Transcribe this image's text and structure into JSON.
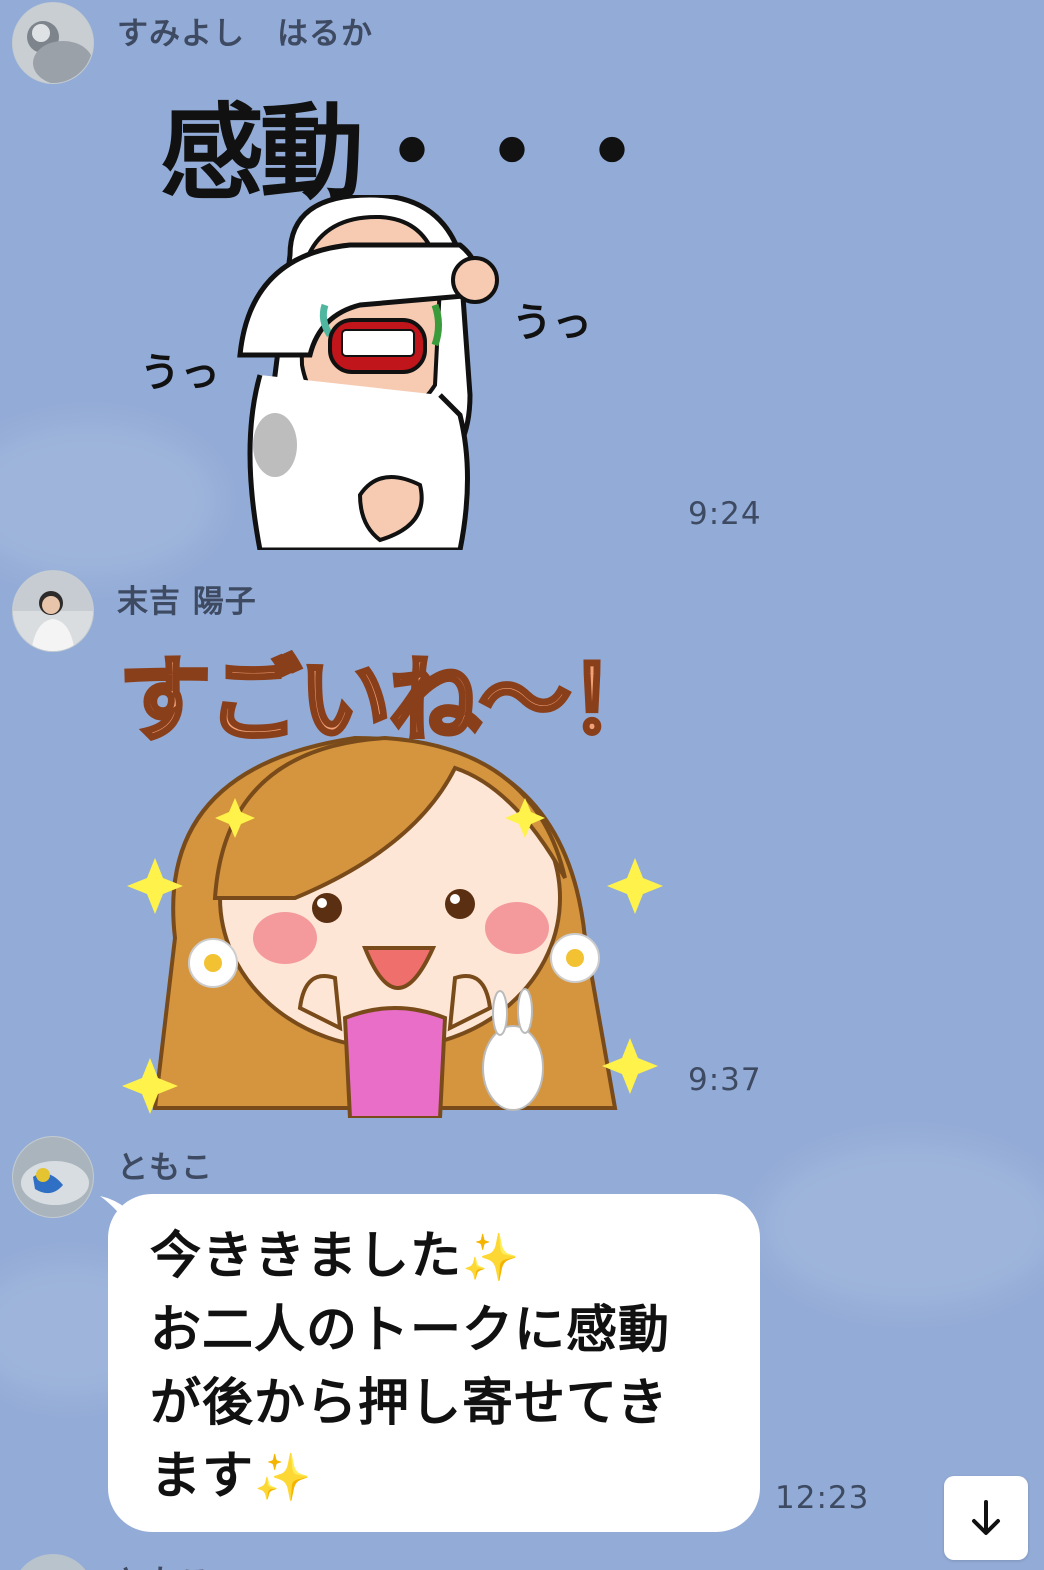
{
  "chat": {
    "messages": [
      {
        "sender": "すみよし　はるか",
        "type": "sticker",
        "sticker_text": "感動・・・",
        "sticker_sounds": [
          "うっ",
          "うっ"
        ],
        "time": "9:24"
      },
      {
        "sender": "末吉 陽子",
        "type": "sticker",
        "sticker_text": "すごいね〜！",
        "time": "9:37"
      },
      {
        "sender": "ともこ",
        "type": "text",
        "lines": [
          "今ききました",
          "お二人のトークに感動",
          "が後から押し寄せてき",
          "ます"
        ],
        "time": "12:23"
      }
    ],
    "next_sender_peek": "ともこ"
  },
  "colors": {
    "background": "#93acd7",
    "bubble": "#ffffff",
    "meta_text": "#3d4a62"
  },
  "icons": {
    "scroll_down": "arrow-down-icon",
    "sparkle": "sparkle-icon"
  }
}
